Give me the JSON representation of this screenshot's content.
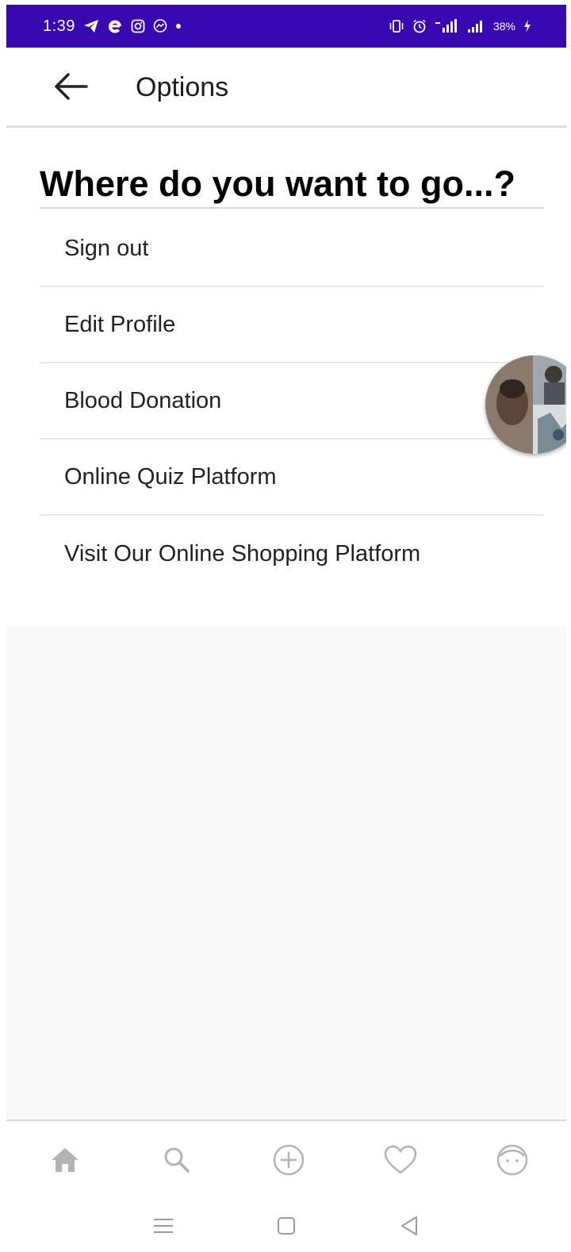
{
  "status_bar": {
    "time": "1:39",
    "battery": "38%",
    "left_icons": [
      "telegram-icon",
      "e-app-icon",
      "instagram-icon",
      "messenger-icon",
      "dot-icon"
    ],
    "right_icons": [
      "vibrate-icon",
      "alarm-icon",
      "signal-icon",
      "signal-icon"
    ],
    "bg_color": "#3a08b0"
  },
  "app_bar": {
    "title": "Options",
    "back_icon": "arrow-left-icon"
  },
  "main": {
    "heading": "Where do you want to go...?",
    "menu_items": [
      {
        "label": "Sign out"
      },
      {
        "label": "Edit Profile"
      },
      {
        "label": "Blood Donation"
      },
      {
        "label": "Online Quiz Platform"
      },
      {
        "label": "Visit Our Online Shopping Platform"
      }
    ]
  },
  "bottom_nav": {
    "items": [
      {
        "icon": "home-icon"
      },
      {
        "icon": "search-icon"
      },
      {
        "icon": "add-circle-icon"
      },
      {
        "icon": "heart-icon"
      },
      {
        "icon": "profile-face-icon"
      }
    ],
    "icon_color": "#b3b3b3"
  },
  "system_nav": {
    "items": [
      {
        "icon": "recents-icon"
      },
      {
        "icon": "home-square-icon"
      },
      {
        "icon": "back-triangle-icon"
      }
    ]
  }
}
